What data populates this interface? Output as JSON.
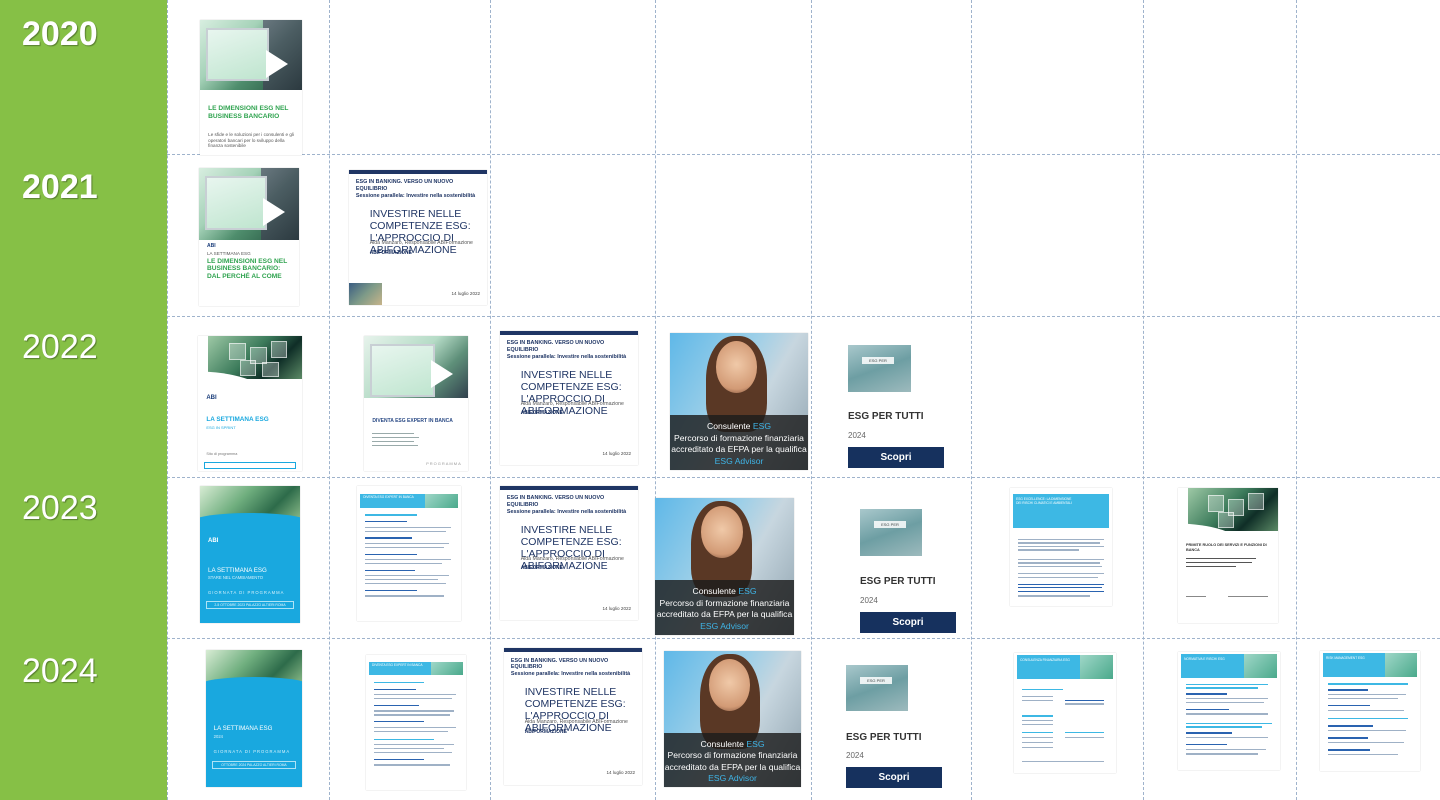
{
  "years": [
    {
      "label": "2020"
    },
    {
      "label": "2021"
    },
    {
      "label": "2022"
    },
    {
      "label": "2023"
    },
    {
      "label": "2024"
    }
  ],
  "colors": {
    "sidebar": "#86c046",
    "abi_blue": "#1f3564",
    "esg_cyan": "#19a8df",
    "gridline": "#9fb3cc"
  },
  "thumbs": {
    "esg_dimensioni_2020": {
      "title": "LE DIMENSIONI ESG NEL BUSINESS BANCARIO",
      "subtitle": "Le sfide e le soluzioni per i consulenti e gli operatori bancari per lo sviluppo della finanza sostenibile"
    },
    "esg_dimensioni_2021": {
      "brand": "ABI",
      "kicker": "LA SETTIMANA ESG",
      "title": "LE DIMENSIONI ESG NEL BUSINESS BANCARIO: DAL PERCHÉ AL COME"
    },
    "investire_slide": {
      "kicker": "ESG IN BANKING. VERSO UN NUOVO EQUILIBRIO",
      "kicker2": "Sessione parallela: Investire nella sostenibilità",
      "title": "INVESTIRE NELLE COMPETENZE ESG: L'APPROCCIO DI ABIFORMAZIONE",
      "speaker": "Aida Manzaro, Responsabile ABIFormazione",
      "logo": "ABIFORMAZIONE",
      "date": "14 luglio 2022"
    },
    "settimana_2022": {
      "brand": "ABI",
      "title": "LA SETTIMANA ESG",
      "subtitle": "ESG IN SPRINT",
      "small": "Sito di programma"
    },
    "expert_2022": {
      "title": "DIVENTA ESG EXPERT IN BANCA",
      "footer": "PROGRAMMA"
    },
    "consulente": {
      "line1_a": "Consulente ",
      "line1_b": "ESG",
      "line2": "Percorso di formazione finanziaria",
      "line3_a": "accreditato da EFPA per la qualifica ",
      "line3_b": "ESG Advisor"
    },
    "esg_per_tutti": {
      "chip": "ESG PER",
      "title": "ESG PER TUTTI",
      "year": "2024",
      "button": "Scopri"
    },
    "settimana_2023": {
      "brand": "ABI",
      "title": "LA SETTIMANA ESG",
      "subtitle": "STARE NEL CAMBIAMENTO",
      "small": "GIORNATA DI PROGRAMMA",
      "box": "2-5 OTTOBRE 2023 PALAZZO ALTIERI ROMA"
    },
    "settimana_2024": {
      "brand": "ABI",
      "title": "LA SETTIMANA ESG",
      "subtitle": "2024",
      "small": "GIORNATA DI PROGRAMMA",
      "box": "OTTOBRE 2024 PALAZZO ALTIERI ROMA"
    },
    "expert_2023": {
      "header": "DIVENTA ESG EXPERT IN BANCA",
      "section": "PROGRAMMA DI CERTIFICAZIONE"
    },
    "doc_2023": {
      "header": "ESG EXCELLENCE: LA DIMENSIONE DEI RISCHI CLIMATICI E AMBIENTALI"
    },
    "grid_doc_2023": {
      "title": "PRIMITE RUOLO DEI SERVIZI E FUNZIONI DI BANCA"
    },
    "doc_2024_a": {
      "header": "DIVENTA ESG EXPERT IN BANCA"
    },
    "doc_2024_b": {
      "header": "CONSULENZA FINANZIARIA ESG"
    },
    "doc_2024_c": {
      "header": "NORMATIVA E RISCHI ESG"
    },
    "doc_2024_d": {
      "header": "RISK MANAGEMENT ESG"
    }
  }
}
